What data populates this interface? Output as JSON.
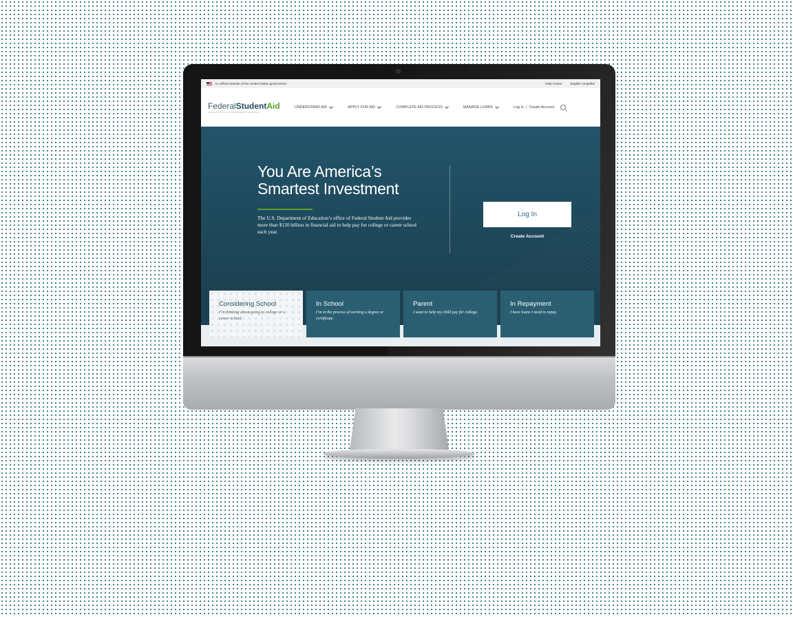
{
  "gov_banner": {
    "text": "An official website of the United States government.",
    "help": "Help Center",
    "lang": "English | Español"
  },
  "logo": {
    "federal": "Federal",
    "student": "Student",
    "aid": "Aid",
    "tagline": "AN OFFICE OF THE U.S. DEPARTMENT OF EDUCATION"
  },
  "nav": {
    "items": [
      {
        "label": "UNDERSTAND AID"
      },
      {
        "label": "APPLY FOR AID"
      },
      {
        "label": "COMPLETE AID PROCESS"
      },
      {
        "label": "MANAGE LOANS"
      }
    ],
    "login": "Log In",
    "separator": "|",
    "create": "Create Account"
  },
  "hero": {
    "title_line1": "You Are America’s",
    "title_line2": "Smartest Investment",
    "description": "The U.S. Department of Education’s office of Federal Student Aid provides more than $120 billion in financial aid to help pay for college or career school each year.",
    "login_button": "Log In",
    "create_account": "Create Account"
  },
  "cards": [
    {
      "title": "Considering School",
      "desc": "I’m thinking about going to college or a career school."
    },
    {
      "title": "In School",
      "desc": "I’m in the process of earning a degree or certificate."
    },
    {
      "title": "Parent",
      "desc": "I want to help my child pay for college."
    },
    {
      "title": "In Repayment",
      "desc": "I have loans I need to repay."
    }
  ],
  "colors": {
    "hero_bg": "#1f4a5d",
    "card_bg": "#2a5f72",
    "accent_green": "#5aa02c",
    "link_blue": "#2f6d8e"
  }
}
